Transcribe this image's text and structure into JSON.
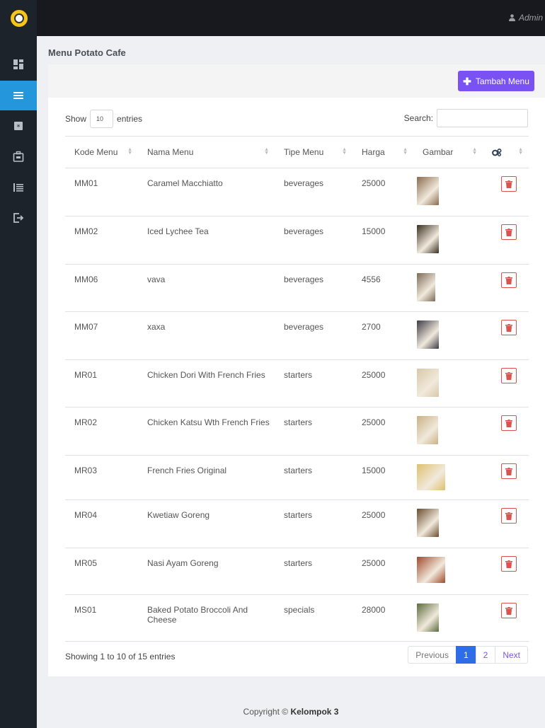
{
  "header": {
    "user_label": "Admin"
  },
  "sidebar": {
    "items": [
      {
        "icon": "dashboard-icon"
      },
      {
        "icon": "menu-list-icon",
        "active": true
      },
      {
        "icon": "asterisk-icon"
      },
      {
        "icon": "briefcase-icon"
      },
      {
        "icon": "report-list-icon"
      },
      {
        "icon": "logout-icon"
      }
    ]
  },
  "page": {
    "title": "Menu Potato Cafe"
  },
  "toolbar": {
    "add_label": "Tambah Menu",
    "accent": "#7a52f4"
  },
  "table_controls": {
    "show_label": "Show",
    "entries_value": "10",
    "entries_label": "entries",
    "search_label": "Search:"
  },
  "table": {
    "columns": [
      "Kode Menu",
      "Nama Menu",
      "Tipe Menu",
      "Harga",
      "Gambar"
    ],
    "settings_icon": "gears-icon",
    "rows": [
      {
        "kode": "MM01",
        "nama": "Caramel Macchiatto",
        "tipe": "beverages",
        "harga": "25000",
        "img": "drink-photo",
        "color": "#8a6a4e"
      },
      {
        "kode": "MM02",
        "nama": "Iced Lychee Tea",
        "tipe": "beverages",
        "harga": "15000",
        "img": "drink-photo",
        "color": "#3a3022"
      },
      {
        "kode": "MM06",
        "nama": "vava",
        "tipe": "beverages",
        "harga": "4556",
        "img": "cat-photo",
        "color": "#7d6a57"
      },
      {
        "kode": "MM07",
        "nama": "xaxa",
        "tipe": "beverages",
        "harga": "2700",
        "img": "room-photo",
        "color": "#3c3b45"
      },
      {
        "kode": "MR01",
        "nama": "Chicken Dori With French Fries",
        "tipe": "starters",
        "harga": "25000",
        "img": "food-photo",
        "color": "#d8c8a8"
      },
      {
        "kode": "MR02",
        "nama": "Chicken Katsu Wth French Fries",
        "tipe": "starters",
        "harga": "25000",
        "img": "food-photo",
        "color": "#c9b183"
      },
      {
        "kode": "MR03",
        "nama": "French Fries Original",
        "tipe": "starters",
        "harga": "15000",
        "img": "fries-photo",
        "color": "#e0c06d"
      },
      {
        "kode": "MR04",
        "nama": "Kwetiaw Goreng",
        "tipe": "starters",
        "harga": "25000",
        "img": "noodle-photo",
        "color": "#6b4c2e"
      },
      {
        "kode": "MR05",
        "nama": "Nasi Ayam Goreng",
        "tipe": "starters",
        "harga": "25000",
        "img": "rice-photo",
        "color": "#a04a2a"
      },
      {
        "kode": "MS01",
        "nama": "Baked Potato Broccoli And Cheese",
        "tipe": "specials",
        "harga": "28000",
        "img": "potato-photo",
        "color": "#5d6b3e"
      }
    ]
  },
  "pagination": {
    "info": "Showing 1 to 10 of 15 entries",
    "previous": "Previous",
    "page1": "1",
    "page2": "2",
    "next": "Next"
  },
  "footer": {
    "prefix": "Copyright ©",
    "brand": "Kelompok 3"
  }
}
